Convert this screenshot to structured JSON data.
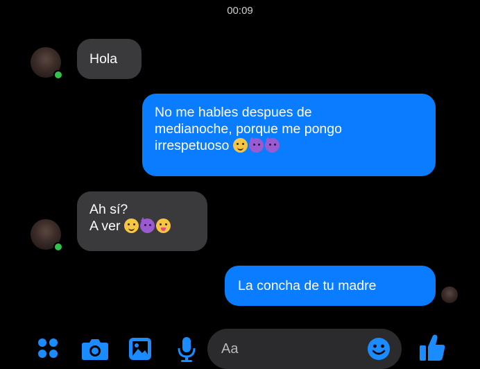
{
  "status_bar": {
    "time": "00:09"
  },
  "messages": [
    {
      "direction": "incoming",
      "lines": [
        "Hola"
      ],
      "emojis": []
    },
    {
      "direction": "outgoing",
      "lines": [
        "No me hables despues de",
        "medianoche, porque me pongo",
        "irrespetuoso"
      ],
      "emojis": [
        "smirking-face",
        "smiling-face-with-horns",
        "smiling-face-with-horns"
      ]
    },
    {
      "direction": "incoming",
      "lines": [
        "Ah sí?",
        "A ver"
      ],
      "emojis": [
        "smirking-face",
        "smiling-face-with-horns",
        "face-with-tongue"
      ]
    },
    {
      "direction": "outgoing",
      "lines": [
        "La concha de tu madre"
      ],
      "emojis": []
    }
  ],
  "composer": {
    "placeholder": "Aa",
    "icons": [
      "grid-menu-icon",
      "camera-icon",
      "gallery-icon",
      "microphone-icon",
      "emoji-icon",
      "thumbs-up-icon"
    ]
  },
  "colors": {
    "outgoing_bubble": "#0a7cff",
    "incoming_bubble": "#3a3a3c",
    "background": "#000000",
    "online": "#31c24b",
    "accent": "#1b8cff"
  }
}
